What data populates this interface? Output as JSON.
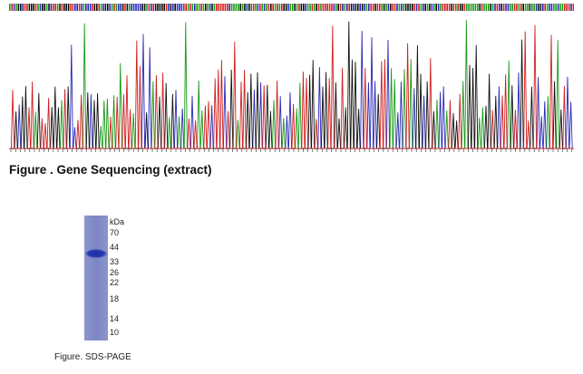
{
  "sequencing_figure": {
    "caption": "Figure . Gene Sequencing (extract)",
    "trace_colors": {
      "A": "#1a9a1a",
      "C": "#2a2ab8",
      "G": "#111111",
      "T": "#d02020"
    }
  },
  "gel_figure": {
    "unit_label": "kDa",
    "markers": [
      "70",
      "44",
      "33",
      "26",
      "22",
      "18",
      "14",
      "10"
    ],
    "caption": "Figure. SDS-PAGE",
    "lane_color": "#7f89c3",
    "band_color": "#2233a8"
  }
}
